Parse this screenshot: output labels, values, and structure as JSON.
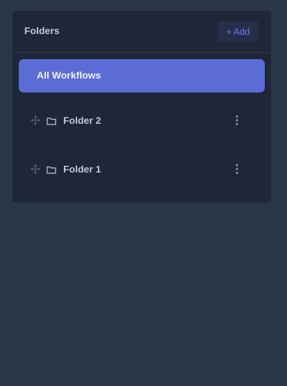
{
  "panel": {
    "title": "Folders",
    "add_label": "+ Add"
  },
  "all_workflows": {
    "label": "All Workflows"
  },
  "folders": [
    {
      "label": "Folder 2"
    },
    {
      "label": "Folder 1"
    }
  ],
  "icons": {
    "drag": "drag-handle-icon",
    "folder": "folder-icon",
    "more": "more-vertical-icon"
  },
  "colors": {
    "background": "#2a3548",
    "panel": "#1e2638",
    "accent": "#5c6cd6",
    "add_text": "#6b7ff0",
    "text": "#c3c9d6"
  }
}
